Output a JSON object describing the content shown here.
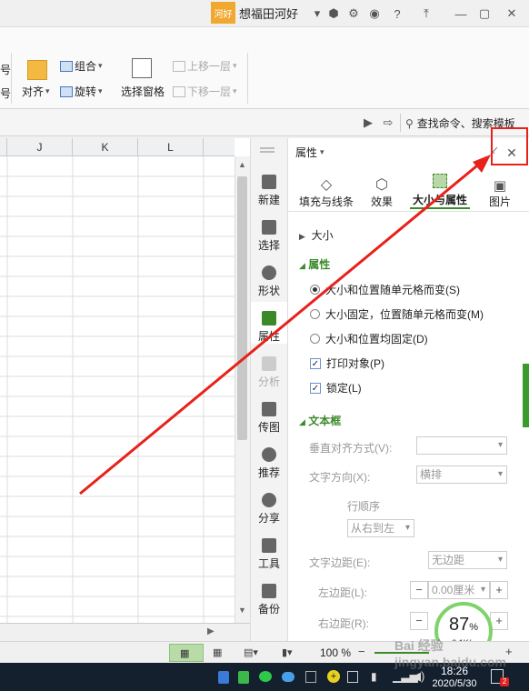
{
  "titlebar": {
    "brand": "河好",
    "user": "想福田河好"
  },
  "ribbon": {
    "row1": [
      "组合",
      "上移一层"
    ],
    "row2": [
      "对齐",
      "旋转",
      "选择窗格",
      "下移一层"
    ],
    "edge_chars": [
      "号",
      "号"
    ],
    "search": "查找命令、搜索模板"
  },
  "sheet": {
    "columns": [
      "J",
      "K",
      "L"
    ]
  },
  "sidebar": [
    "新建",
    "选择",
    "形状",
    "属性",
    "分析",
    "传图",
    "推荐",
    "分享",
    "工具",
    "备份"
  ],
  "panel": {
    "title": "属性",
    "tabs": [
      "填充与线条",
      "效果",
      "大小与属性",
      "图片"
    ],
    "size_section": "大小",
    "props_section": "属性",
    "radios": [
      "大小和位置随单元格而变(S)",
      "大小固定，位置随单元格而变(M)",
      "大小和位置均固定(D)"
    ],
    "checks": [
      "打印对象(P)",
      "锁定(L)"
    ],
    "textbox_section": "文本框",
    "valign_label": "垂直对齐方式(V):",
    "valign_value": "",
    "dir_label": "文字方向(X):",
    "dir_value": "横排",
    "row_order_label": "行顺序",
    "row_order_value": "从右到左",
    "margin_label": "文字边距(E):",
    "margin_value": "无边距",
    "left_margin_label": "左边距(L):",
    "left_margin_value": "0.00厘米",
    "right_margin_label": "右边距(R):"
  },
  "status": {
    "zoom": "100 %"
  },
  "speed": {
    "percent": "87",
    "unit": "%",
    "rate": "0.1K/s"
  },
  "taskbar": {
    "time": "18:26",
    "date": "2020/5/30"
  },
  "watermark": "Bai 经验 jingyan.baidu.com",
  "colors": {
    "accent_green": "#3a8a2a",
    "annotation_red": "#e8211a"
  }
}
